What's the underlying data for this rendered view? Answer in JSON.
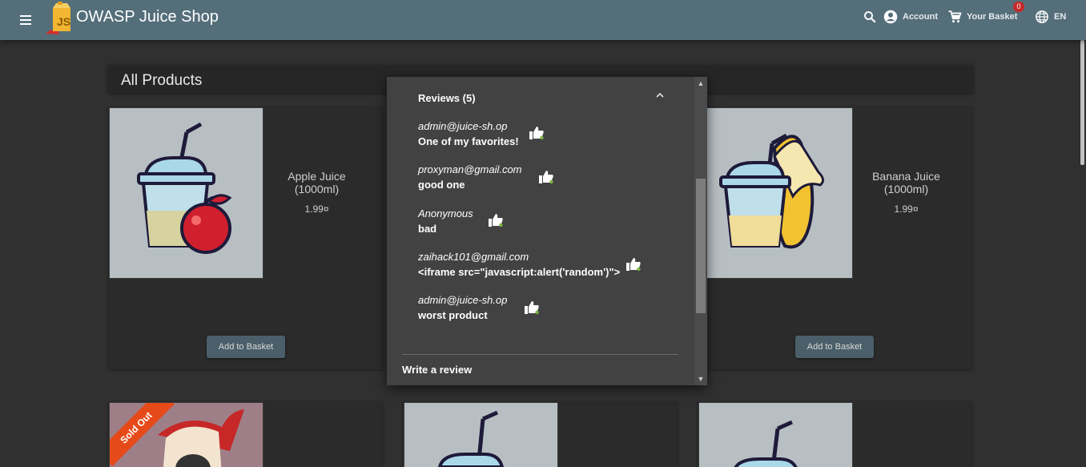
{
  "app": {
    "title": "OWASP Juice Shop"
  },
  "toolbar": {
    "account_label": "Account",
    "basket_label": "Your Basket",
    "basket_count": "0",
    "language": "EN"
  },
  "page": {
    "section_title": "All Products"
  },
  "products": [
    {
      "name": "Apple Juice\n(1000ml)",
      "price": "1.99¤",
      "button": "Add to Basket"
    },
    {
      "name": "Banana Juice\n(1000ml)",
      "price": "1.99¤",
      "button": "Add to Basket"
    }
  ],
  "sold_out_label": "Sold Out",
  "dialog": {
    "reviews_title": "Reviews (5)",
    "reviews": [
      {
        "author": "admin@juice-sh.op",
        "message": "One of my favorites!"
      },
      {
        "author": "proxyman@gmail.com",
        "message": "good one"
      },
      {
        "author": "Anonymous",
        "message": "bad"
      },
      {
        "author": "zaihack101@gmail.com",
        "message": "<iframe src=\"javascript:alert('random')\">"
      },
      {
        "author": "admin@juice-sh.op",
        "message": "worst product"
      }
    ],
    "write_review_label": "Write a review"
  },
  "colors": {
    "toolbar": "#546e7a",
    "background": "#303030",
    "dialog": "#424242",
    "button": "#4a5f6a",
    "sold_out": "#e64a19",
    "badge": "#c62828"
  },
  "icons": [
    "menu-icon",
    "juice-shop-logo",
    "search-icon",
    "account-icon",
    "cart-icon",
    "language-icon",
    "chevron-up-icon",
    "thumbs-up-icon"
  ]
}
